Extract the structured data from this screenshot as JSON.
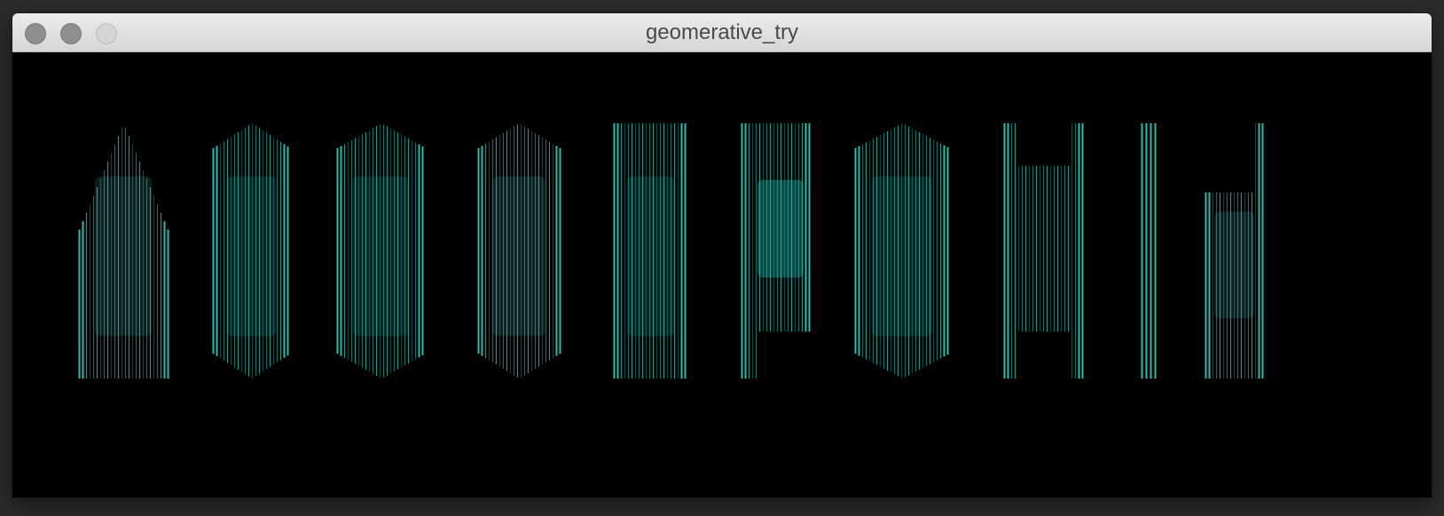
{
  "window": {
    "title": "geomerative_try"
  },
  "controls": {
    "close_icon": "close-icon",
    "minimize_icon": "minimize-icon",
    "zoom_icon": "zoom-icon"
  },
  "canvas": {
    "background": "#000000",
    "stroke_color": "#2ec4b6",
    "fill_color": "#1f5a55",
    "glyphs": [
      "A",
      "B",
      "C",
      "D",
      "E",
      "F",
      "G",
      "H",
      "I",
      "J"
    ]
  }
}
